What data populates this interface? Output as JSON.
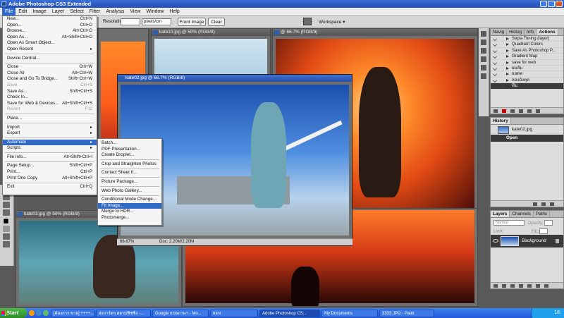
{
  "app": {
    "title": "Adobe Photoshop CS3 Extended"
  },
  "menubar": [
    "File",
    "Edit",
    "Image",
    "Layer",
    "Select",
    "Filter",
    "Analysis",
    "View",
    "Window",
    "Help"
  ],
  "options": {
    "resolution_label": "Resolution:",
    "resolution_value": "",
    "resolution_unit": "pixels/cm",
    "front_image": "Front Image",
    "clear": "Clear",
    "workspace": "Workspace ▾"
  },
  "file_menu": [
    {
      "label": "New...",
      "shortcut": "Ctrl+N"
    },
    {
      "label": "Open...",
      "shortcut": "Ctrl+O"
    },
    {
      "label": "Browse...",
      "shortcut": "Alt+Ctrl+O"
    },
    {
      "label": "Open As...",
      "shortcut": "Alt+Shift+Ctrl+O"
    },
    {
      "label": "Open As Smart Object...",
      "shortcut": ""
    },
    {
      "label": "Open Recent",
      "shortcut": "▸"
    },
    {
      "sep": true
    },
    {
      "label": "Device Central...",
      "shortcut": ""
    },
    {
      "sep": true
    },
    {
      "label": "Close",
      "shortcut": "Ctrl+W"
    },
    {
      "label": "Close All",
      "shortcut": "Alt+Ctrl+W"
    },
    {
      "label": "Close and Go To Bridge...",
      "shortcut": "Shift+Ctrl+W"
    },
    {
      "label": "Save",
      "shortcut": "Ctrl+S",
      "disabled": true
    },
    {
      "label": "Save As...",
      "shortcut": "Shift+Ctrl+S"
    },
    {
      "label": "Check In...",
      "shortcut": ""
    },
    {
      "label": "Save for Web & Devices...",
      "shortcut": "Alt+Shift+Ctrl+S"
    },
    {
      "label": "Revert",
      "shortcut": "F12",
      "disabled": true
    },
    {
      "sep": true
    },
    {
      "label": "Place...",
      "shortcut": ""
    },
    {
      "sep": true
    },
    {
      "label": "Import",
      "shortcut": "▸"
    },
    {
      "label": "Export",
      "shortcut": "▸"
    },
    {
      "sep": true
    },
    {
      "label": "Automate",
      "shortcut": "▸",
      "highlighted": true
    },
    {
      "label": "Scripts",
      "shortcut": "▸"
    },
    {
      "sep": true
    },
    {
      "label": "File Info...",
      "shortcut": "Alt+Shift+Ctrl+I"
    },
    {
      "sep": true
    },
    {
      "label": "Page Setup...",
      "shortcut": "Shift+Ctrl+P"
    },
    {
      "label": "Print...",
      "shortcut": "Ctrl+P"
    },
    {
      "label": "Print One Copy",
      "shortcut": "Alt+Shift+Ctrl+P"
    },
    {
      "sep": true
    },
    {
      "label": "Exit",
      "shortcut": "Ctrl+Q"
    }
  ],
  "automate_menu": [
    {
      "label": "Batch..."
    },
    {
      "label": "PDF Presentation..."
    },
    {
      "label": "Create Droplet..."
    },
    {
      "sep": true
    },
    {
      "label": "Crop and Straighten Photos"
    },
    {
      "sep": true
    },
    {
      "label": "Contact Sheet II..."
    },
    {
      "sep": true
    },
    {
      "label": "Picture Package..."
    },
    {
      "sep": true
    },
    {
      "label": "Web Photo Gallery..."
    },
    {
      "sep": true
    },
    {
      "label": "Conditional Mode Change..."
    },
    {
      "label": "Fit Image...",
      "highlighted": true
    },
    {
      "label": "Merge to HDR..."
    },
    {
      "label": "Photomerge..."
    }
  ],
  "documents": {
    "doc1": "kate10.jpg @ 50% (RGB/8)",
    "doc2": "@ 66.7% (RGB/8)",
    "doc3": "kate02.jpg @ 66.7% (RGB/8)",
    "doc4": "kate03.jpg @ 50% (RGB/8)",
    "zoom": "66.67%",
    "docsize": "Doc: 2.20M/2.20M"
  },
  "actions_panel": {
    "tabs": [
      "Navig",
      "Histog",
      "Info",
      "Actions"
    ],
    "items": [
      "Sepia Toning (layer)",
      "Quadrant Colors",
      "Save As Photoshop P...",
      "Gradient Map",
      "save for web",
      "ผมส้ม",
      "ยอดพ",
      "ลองมังคุด",
      "ทีม"
    ]
  },
  "history_panel": {
    "title": "History",
    "snapshot": "kate02.jpg",
    "state": "Open"
  },
  "layers_panel": {
    "tabs": [
      "Layers",
      "Channels",
      "Paths"
    ],
    "blend": "Normal",
    "opacity_label": "Opacity:",
    "lock_label": "Lock:",
    "fill_label": "Fill:",
    "layer_name": "Background"
  },
  "taskbar": {
    "start": "Start",
    "items": [
      "[ต้องการ ขาย] ++++...",
      "ส่งการ์ดๆ สยามฟิชซิ่ง -...",
      "Google แปลภาษา - Mo...",
      "mini",
      "Adobe Photoshop CS...",
      "My Documents",
      "3333.JPG - Paint"
    ],
    "clock": "16:"
  }
}
